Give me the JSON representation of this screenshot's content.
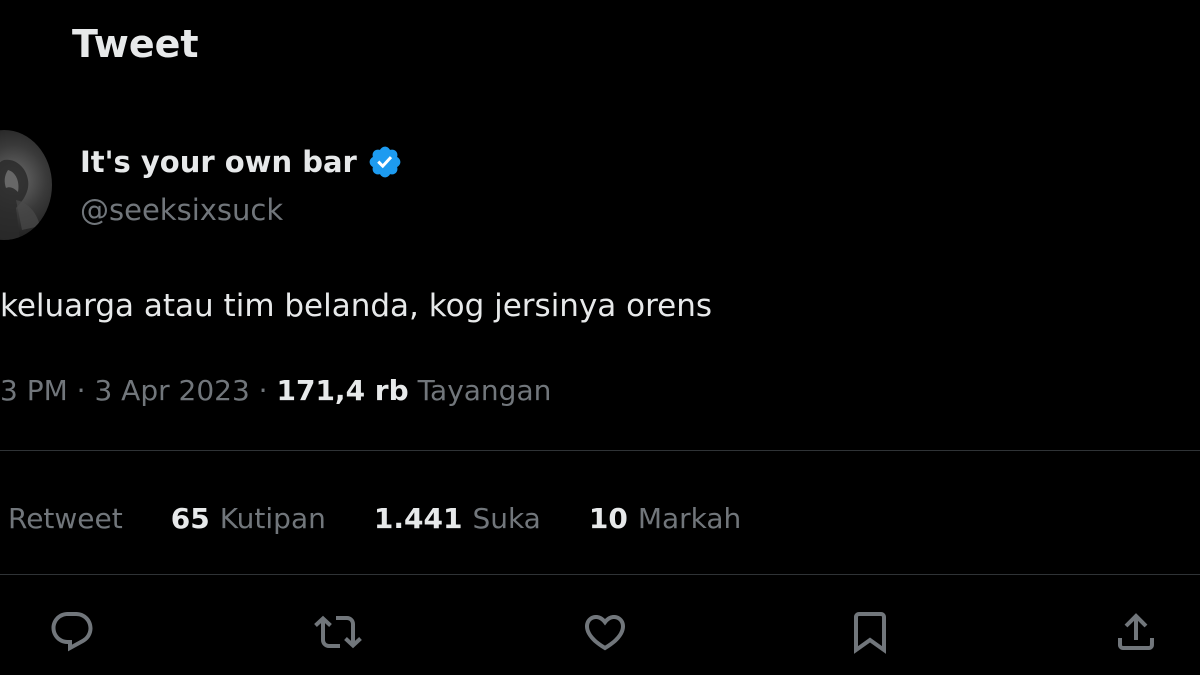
{
  "header": {
    "title": "Tweet"
  },
  "author": {
    "display_name": "It's your own bar",
    "handle": "@seeksixsuck",
    "verified_icon": "verified-badge-icon",
    "verified_color": "#1d9bf0"
  },
  "tweet": {
    "text": "keluarga atau tim belanda, kog jersinya orens",
    "time": "3 PM",
    "separator1": " · ",
    "date": "3 Apr 2023",
    "separator2": " · ",
    "views_count": "171,4 rb",
    "views_label": "Tayangan"
  },
  "stats": {
    "retweet_label": "Retweet",
    "quotes_count": "65",
    "quotes_label": "Kutipan",
    "likes_count": "1.441",
    "likes_label": "Suka",
    "bookmarks_count": "10",
    "bookmarks_label": "Markah"
  },
  "actions": [
    {
      "icon": "reply-icon"
    },
    {
      "icon": "retweet-icon"
    },
    {
      "icon": "like-icon"
    },
    {
      "icon": "bookmark-icon"
    },
    {
      "icon": "share-icon"
    }
  ],
  "colors": {
    "background": "#000000",
    "primary_text": "#e7e9ea",
    "secondary_text": "#71767b",
    "divider": "#2f3336",
    "accent": "#1d9bf0"
  }
}
